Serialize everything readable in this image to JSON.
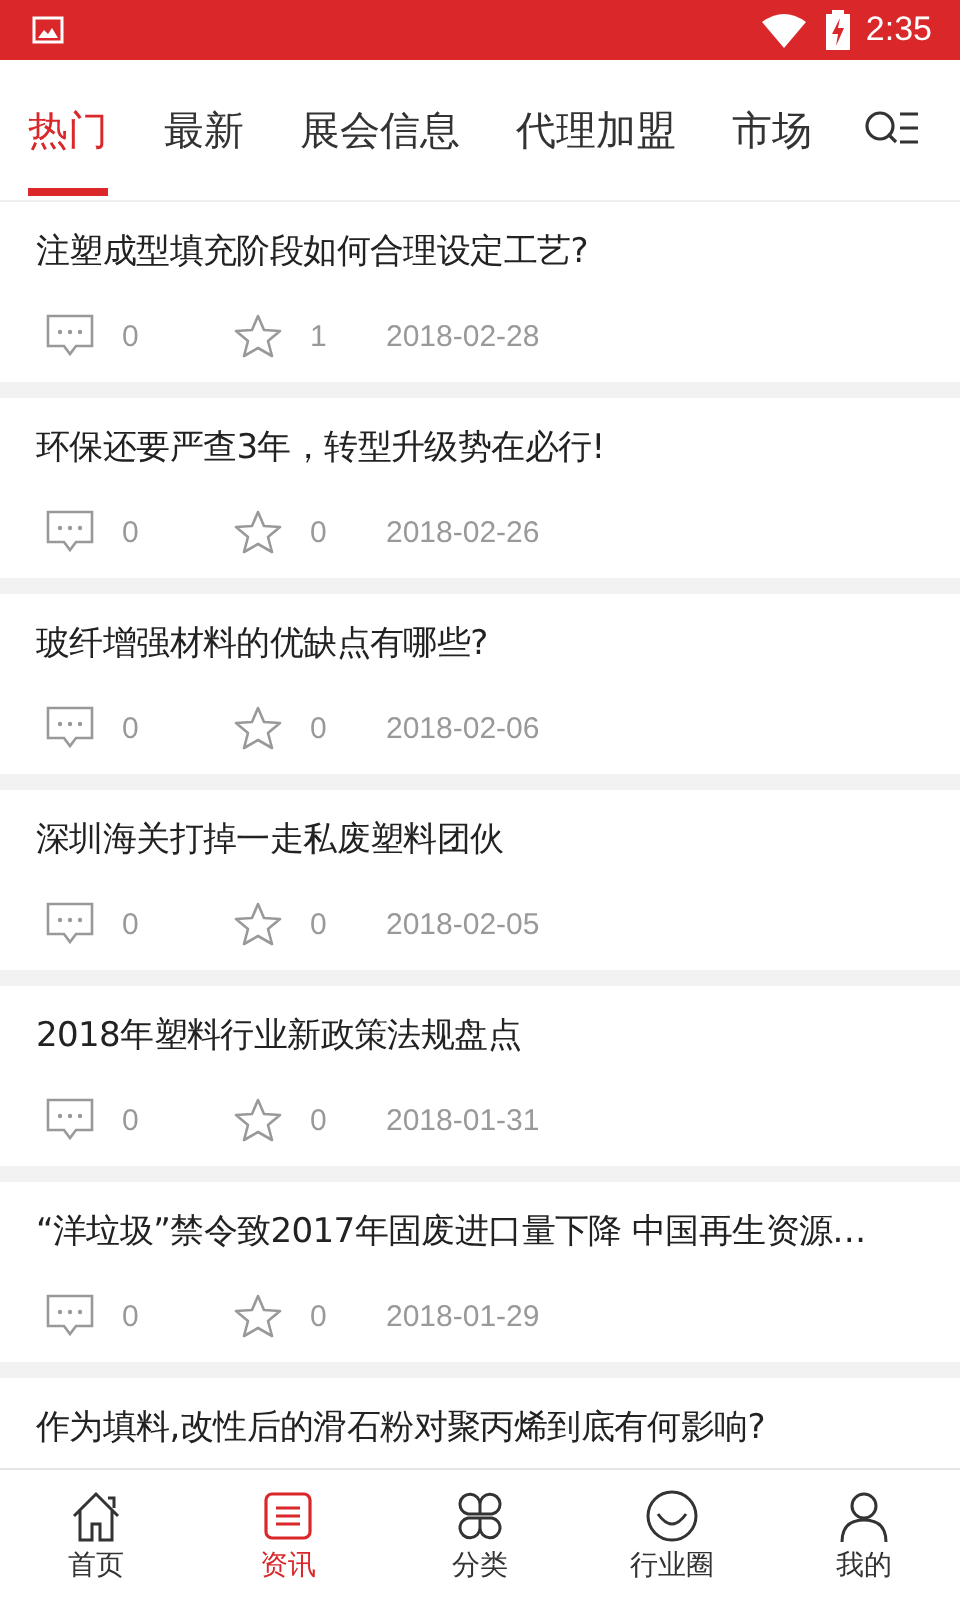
{
  "status_bar": {
    "time": "2:35"
  },
  "tabs": [
    {
      "label": "热门",
      "selected": true
    },
    {
      "label": "最新",
      "selected": false
    },
    {
      "label": "展会信息",
      "selected": false
    },
    {
      "label": "代理加盟",
      "selected": false
    },
    {
      "label": "市场",
      "selected": false
    }
  ],
  "articles": [
    {
      "title": "注塑成型填充阶段如何合理设定工艺?",
      "comments": "0",
      "favorites": "1",
      "date": "2018-02-28"
    },
    {
      "title": "环保还要严查3年，转型升级势在必行!",
      "comments": "0",
      "favorites": "0",
      "date": "2018-02-26"
    },
    {
      "title": "玻纤增强材料的优缺点有哪些?",
      "comments": "0",
      "favorites": "0",
      "date": "2018-02-06"
    },
    {
      "title": "深圳海关打掉一走私废塑料团伙",
      "comments": "0",
      "favorites": "0",
      "date": "2018-02-05"
    },
    {
      "title": "2018年塑料行业新政策法规盘点",
      "comments": "0",
      "favorites": "0",
      "date": "2018-01-31"
    },
    {
      "title": "“洋垃圾”禁令致2017年固废进口量下降 中国再生资源…",
      "comments": "0",
      "favorites": "0",
      "date": "2018-01-29"
    },
    {
      "title": "作为填料,改性后的滑石粉对聚丙烯到底有何影响?"
    }
  ],
  "bottom_nav": [
    {
      "label": "首页",
      "kind": "home",
      "selected": false
    },
    {
      "label": "资讯",
      "kind": "news",
      "selected": true
    },
    {
      "label": "分类",
      "kind": "category",
      "selected": false
    },
    {
      "label": "行业圈",
      "kind": "circle",
      "selected": false
    },
    {
      "label": "我的",
      "kind": "profile",
      "selected": false
    }
  ]
}
